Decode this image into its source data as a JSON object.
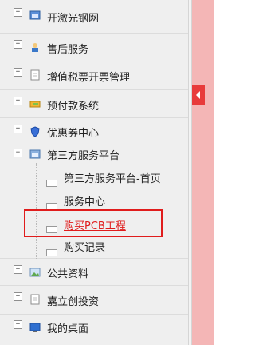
{
  "menu": {
    "items": [
      {
        "label": "开激光钢网",
        "toggle": "+"
      },
      {
        "label": "售后服务",
        "toggle": "+"
      },
      {
        "label": "增值税票开票管理",
        "toggle": "+"
      },
      {
        "label": "预付款系统",
        "toggle": "+"
      },
      {
        "label": "优惠券中心",
        "toggle": "+"
      },
      {
        "label": "第三方服务平台",
        "toggle": "−"
      },
      {
        "label": "公共资料",
        "toggle": "+"
      },
      {
        "label": "嘉立创投资",
        "toggle": "+"
      },
      {
        "label": "我的桌面",
        "toggle": "+"
      }
    ],
    "children": [
      {
        "label": "第三方服务平台-首页"
      },
      {
        "label": "服务中心"
      },
      {
        "label": "购买PCB工程"
      },
      {
        "label": "购买记录"
      }
    ]
  },
  "colors": {
    "highlight": "#e01c1c",
    "collapse_bar": "#f4b6b6",
    "row_bg": "#efefef"
  },
  "icons": [
    "window-icon",
    "user-icon",
    "document-icon",
    "wallet-icon",
    "shield-icon",
    "window-icon",
    "image-icon",
    "document-icon",
    "desktop-icon"
  ]
}
